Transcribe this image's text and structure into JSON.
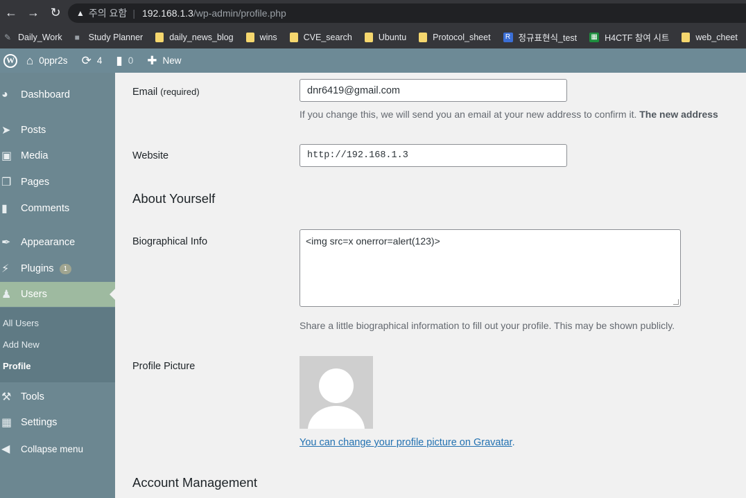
{
  "browser": {
    "warning_text": "주의 요함",
    "url_host": "192.168.1.3",
    "url_path": "/wp-admin/profile.php"
  },
  "bookmarks": [
    {
      "label": "Daily_Work",
      "icon": "pen-icon"
    },
    {
      "label": "Study Planner",
      "icon": "planner-icon"
    },
    {
      "label": "daily_news_blog",
      "icon": "folder-icon"
    },
    {
      "label": "wins",
      "icon": "folder-icon"
    },
    {
      "label": "CVE_search",
      "icon": "folder-icon"
    },
    {
      "label": "Ubuntu",
      "icon": "folder-icon"
    },
    {
      "label": "Protocol_sheet",
      "icon": "folder-icon"
    },
    {
      "label": "정규표현식_test",
      "icon": "r-icon"
    },
    {
      "label": "H4CTF 참여 시트",
      "icon": "sheets-icon"
    },
    {
      "label": "web_cheet",
      "icon": "folder-icon"
    }
  ],
  "admin_bar": {
    "site_name": "0ppr2s",
    "updates_count": "4",
    "comments_count": "0",
    "new_label": "New"
  },
  "sidebar": {
    "items": [
      {
        "label": "Dashboard"
      },
      {
        "label": "Posts"
      },
      {
        "label": "Media"
      },
      {
        "label": "Pages"
      },
      {
        "label": "Comments"
      },
      {
        "label": "Appearance"
      },
      {
        "label": "Plugins",
        "badge": "1"
      },
      {
        "label": "Users"
      },
      {
        "label": "Tools"
      },
      {
        "label": "Settings"
      },
      {
        "label": "Collapse menu"
      }
    ],
    "submenu": [
      {
        "label": "All Users"
      },
      {
        "label": "Add New"
      },
      {
        "label": "Profile"
      }
    ]
  },
  "form": {
    "email_label": "Email",
    "email_required": "(required)",
    "email_value": "dnr6419@gmail.com",
    "email_desc": "If you change this, we will send you an email at your new address to confirm it.",
    "email_desc_bold": "The new address",
    "website_label": "Website",
    "website_value": "http://192.168.1.3",
    "about_heading": "About Yourself",
    "bio_label": "Biographical Info",
    "bio_value": "<img src=x onerror=alert(123)>",
    "bio_desc": "Share a little biographical information to fill out your profile. This may be shown publicly.",
    "picture_label": "Profile Picture",
    "gravatar_link": "You can change your profile picture on Gravatar",
    "gravatar_suffix": ".",
    "account_heading": "Account Management"
  }
}
